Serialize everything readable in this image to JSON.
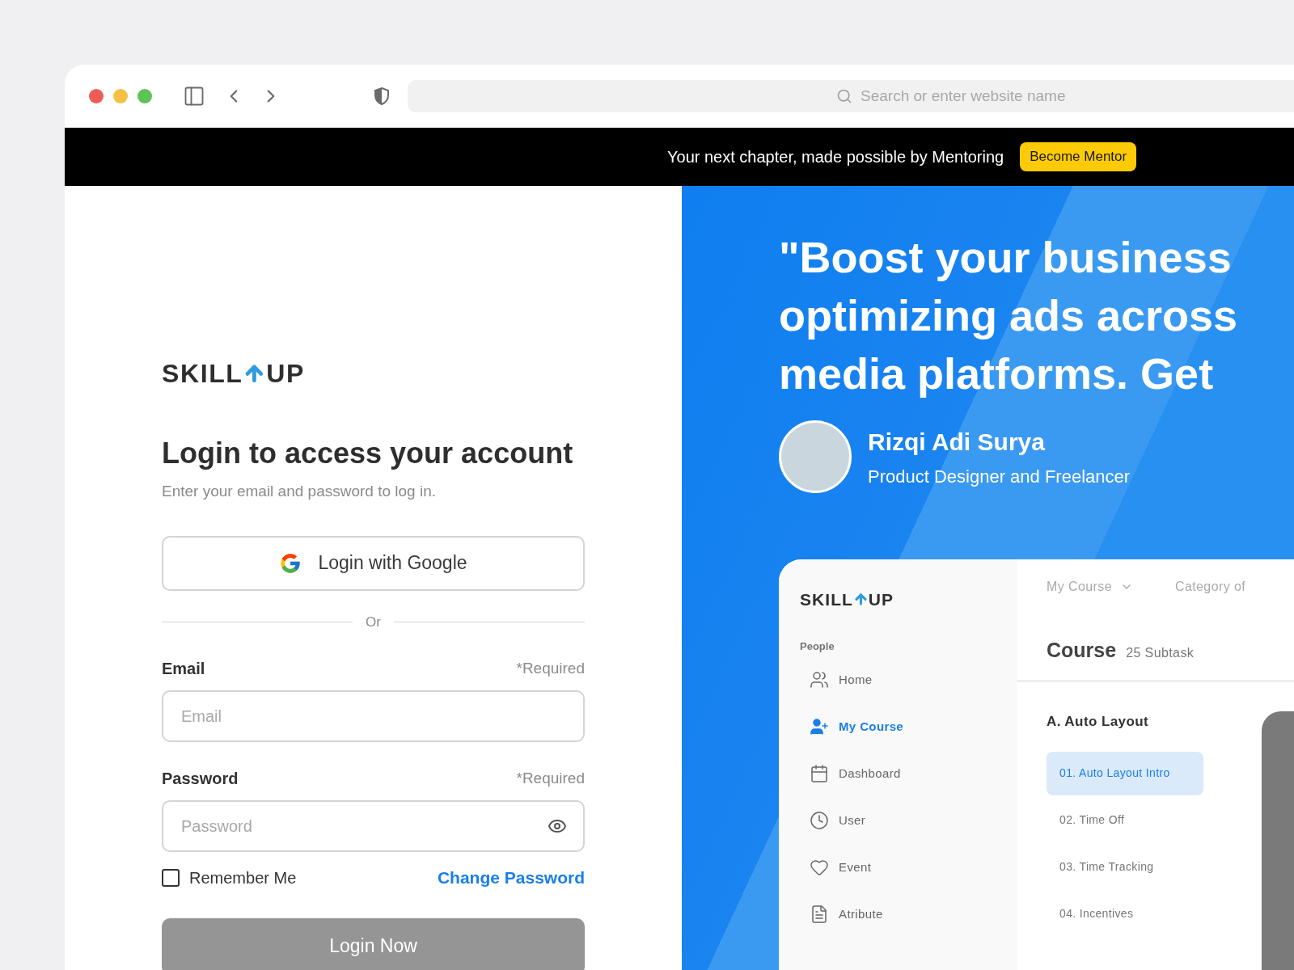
{
  "browser": {
    "address_placeholder": "Search or enter website name"
  },
  "banner": {
    "text": "Your next chapter, made possible by Mentoring",
    "button": "Become Mentor"
  },
  "login": {
    "logo": [
      "SKILL",
      "UP"
    ],
    "title": "Login to access your account",
    "subtitle": "Enter your email and password to log in.",
    "google_button": "Login with Google",
    "divider": "Or",
    "fields": [
      {
        "label": "Email",
        "required": "*Required",
        "placeholder": "Email",
        "kind": "text"
      },
      {
        "label": "Password",
        "required": "*Required",
        "placeholder": "Password",
        "kind": "password"
      }
    ],
    "remember": {
      "label": "Remember Me",
      "checked": false
    },
    "change_password": "Change Password",
    "submit": {
      "label": "Login Now",
      "disabled": true
    }
  },
  "testimonial": {
    "quote_lines": [
      "\"Boost your business",
      "optimizing ads across",
      "media platforms. Get"
    ],
    "name": "Rizqi Adi Surya",
    "role": "Product Designer and Freelancer"
  },
  "dashboard": {
    "logo": [
      "SKILL",
      "UP"
    ],
    "section": "People",
    "sidebar": [
      {
        "label": "Home",
        "selected": false
      },
      {
        "label": "My Course",
        "selected": true
      },
      {
        "label": "Dashboard",
        "selected": false
      },
      {
        "label": "User",
        "selected": false
      },
      {
        "label": "Event",
        "selected": false
      },
      {
        "label": "Atribute",
        "selected": false
      }
    ],
    "nav": [
      {
        "label": "My Course",
        "kind": "dropdown"
      },
      {
        "label": "Category of",
        "kind": "link"
      }
    ],
    "title": "Course",
    "subtitle": "25 Subtask",
    "group": "A. Auto Layout",
    "lessons": [
      {
        "label": "01. Auto Layout Intro",
        "selected": true
      },
      {
        "label": "02. Time Off",
        "selected": false
      },
      {
        "label": "03. Time Tracking",
        "selected": false
      },
      {
        "label": "04. Incentives",
        "selected": false
      }
    ]
  }
}
